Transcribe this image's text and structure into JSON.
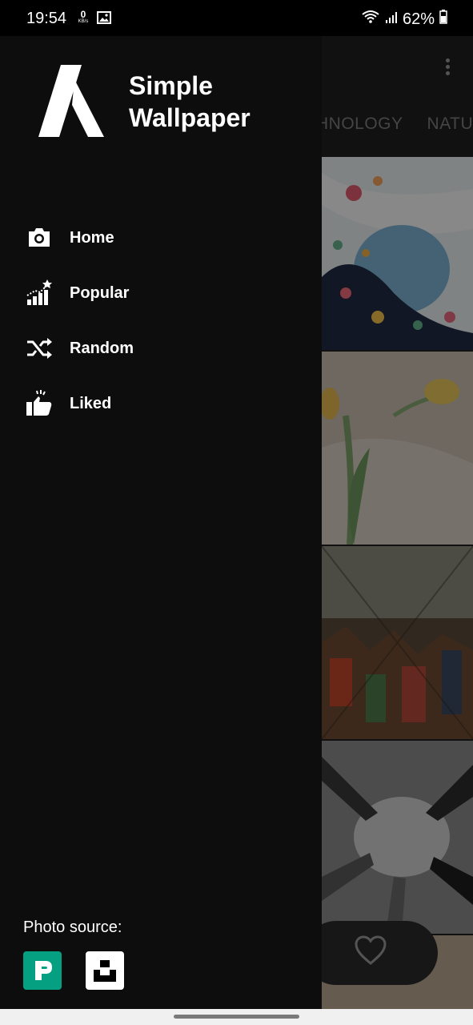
{
  "status_bar": {
    "time": "19:54",
    "net_speed": "0",
    "net_unit": "KB/s",
    "battery": "62%"
  },
  "drawer": {
    "app_name_line1": "Simple",
    "app_name_line2": "Wallpaper",
    "menu": [
      {
        "label": "Home",
        "icon": "camera-icon"
      },
      {
        "label": "Popular",
        "icon": "trending-icon"
      },
      {
        "label": "Random",
        "icon": "shuffle-icon"
      },
      {
        "label": "Liked",
        "icon": "thumbs-up-icon"
      }
    ],
    "photo_source_label": "Photo source:",
    "sources": [
      {
        "icon": "pexels-icon",
        "color": "#05a081"
      },
      {
        "icon": "unsplash-icon",
        "color": "#ffffff"
      }
    ]
  },
  "background_app": {
    "tabs": [
      "HNOLOGY",
      "NATU"
    ],
    "colors": {
      "accent": "#05a081"
    }
  }
}
